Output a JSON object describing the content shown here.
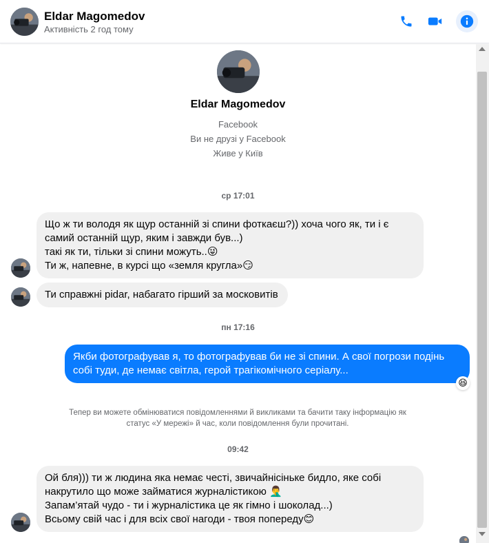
{
  "header": {
    "name": "Eldar Magomedov",
    "status": "Активність 2 год тому",
    "icons": [
      "phone-icon",
      "video-camera-icon",
      "info-icon"
    ],
    "accent_color": "#0a7cff"
  },
  "profile": {
    "name": "Eldar Magomedov",
    "lines": [
      "Facebook",
      "Ви не друзі у Facebook",
      "Живе у Київ"
    ]
  },
  "timestamps": [
    "ср 17:01",
    "пн 17:16",
    "09:42"
  ],
  "messages": [
    {
      "direction": "incoming",
      "text": "Що ж ти володя як щур останній зі спини фоткаєш?)) хоча чого як, ти і є самий останній щур, яким і завжди був...)\n такі як ти, тільки зі спини можуть..😜\nТи ж, напевне, в курсі що «земля кругла»😏"
    },
    {
      "direction": "incoming",
      "text": "Ти справжні pidar, набагато гірший за московитів"
    },
    {
      "direction": "outgoing",
      "text": "Якби фотографував я, то фотографував би не зі спини. А свої погрози подінь собі туди, де немає світла, герой трагікомічного серіалу...",
      "reaction": "😆"
    },
    {
      "direction": "incoming",
      "text": "Ой бля))) ти ж людина яка немає честі, звичайнісінькe бидло, яке собі накрутило що може займатися журналістикою 🤦‍♂️\nЗапам’ятай чудо - ти і журналістика це як гімно і шоколад...)\nВсьому свій час і для всіх свої нагоди - твоя попереду😊"
    }
  ],
  "notice": "Тепер ви можете обмінюватися повідомленнями й викликами та бачити таку інформацію як статус «У мережі» й час, коли повідомлення були прочитані."
}
